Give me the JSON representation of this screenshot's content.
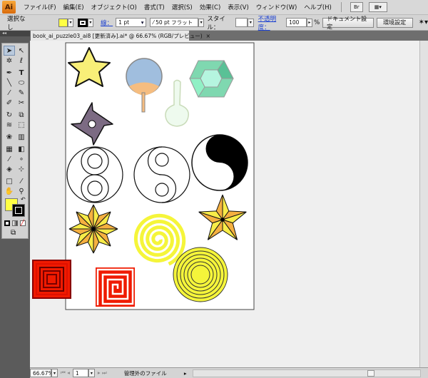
{
  "app": {
    "logo": "Ai"
  },
  "menu": [
    "ファイル(F)",
    "編集(E)",
    "オブジェクト(O)",
    "書式(T)",
    "選択(S)",
    "効果(C)",
    "表示(V)",
    "ウィンドウ(W)",
    "ヘルプ(H)"
  ],
  "menu_icons": {
    "bridge": "Br",
    "arrange": "▦▾"
  },
  "control": {
    "selection": "選択なし",
    "fill_color": "#ffff44",
    "stroke_label": "線：",
    "stroke_weight": "1 pt",
    "brush": "50 pt フラット",
    "style_label": "スタイル：",
    "opacity_label": "不透明度：",
    "opacity": "100",
    "percent": "%",
    "doc_setup": "ドキュメント設定",
    "prefs": "環境設定"
  },
  "tab": {
    "title": "book_ai_puzzle03_ai8 [更新済み].ai* @ 66.67% (RGB/プレビュー)",
    "close": "×"
  },
  "toolbar": {
    "collapse": "◂◂"
  },
  "status": {
    "zoom": "66.67%",
    "page": "1",
    "info": "管理外のファイル"
  }
}
